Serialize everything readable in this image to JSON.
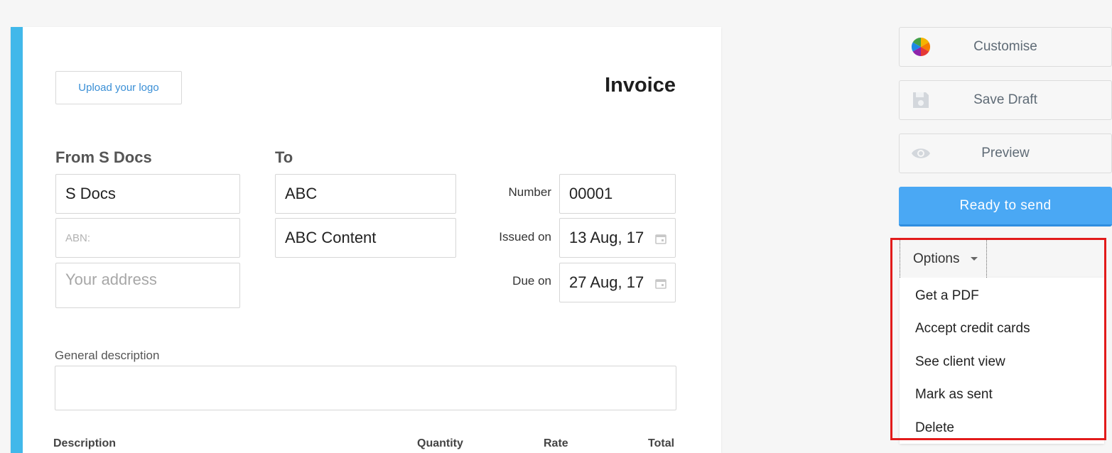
{
  "invoice": {
    "upload_logo_label": "Upload your logo",
    "title": "Invoice",
    "from": {
      "heading": "From S Docs",
      "name_value": "S Docs",
      "abn_placeholder": "ABN:",
      "address_placeholder": "Your address"
    },
    "to": {
      "heading": "To",
      "name_value": "ABC",
      "company_value": "ABC Content"
    },
    "meta": {
      "number_label": "Number",
      "number_value": "00001",
      "issued_label": "Issued on",
      "issued_value": "13 Aug, 17",
      "due_label": "Due on",
      "due_value": "27 Aug, 17",
      "calendar_icon": "calendar-icon"
    },
    "general_description_label": "General description",
    "general_description_value": "",
    "columns": [
      "Description",
      "Quantity",
      "Rate",
      "Total"
    ]
  },
  "sidebar": {
    "customise_label": "Customise",
    "customise_icon": "color-wheel-icon",
    "save_draft_label": "Save Draft",
    "save_icon": "floppy-disk-icon",
    "preview_label": "Preview",
    "preview_icon": "eye-icon",
    "ready_label": "Ready to send",
    "ready_color": "#4aa8f4",
    "options_label": "Options",
    "options_menu": [
      "Get a PDF",
      "Accept credit cards",
      "See client view",
      "Mark as sent",
      "Delete"
    ],
    "highlight_color": "#e21b1b"
  },
  "colors": {
    "accent_bar": "#41b8ea"
  }
}
